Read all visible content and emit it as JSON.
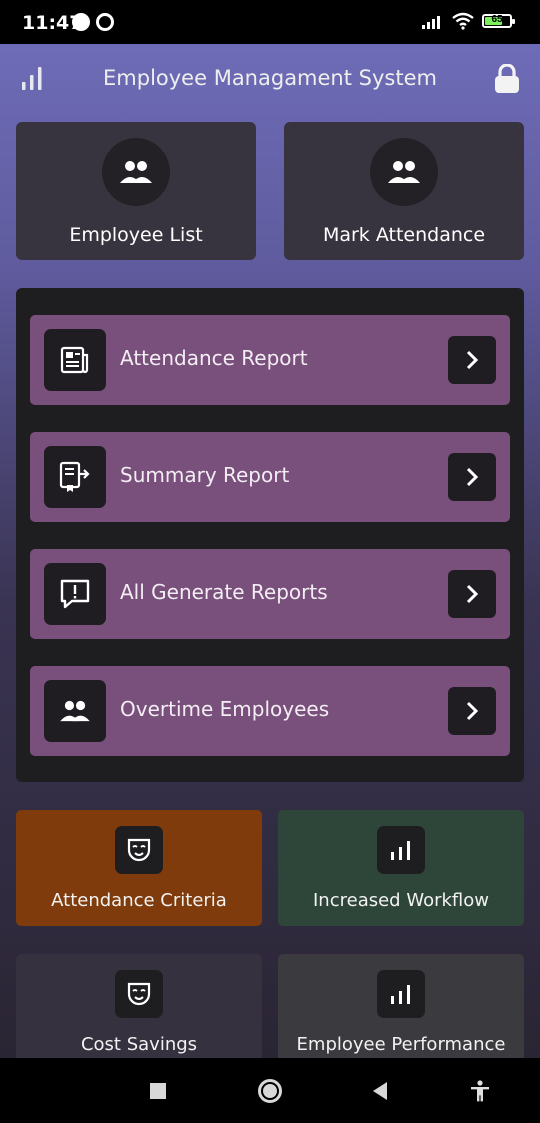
{
  "status_bar": {
    "time": "11:47",
    "battery": "65"
  },
  "app": {
    "title": "Employee Managament System"
  },
  "top_tiles": [
    {
      "label": "Employee List",
      "icon": "people-icon"
    },
    {
      "label": "Mark Attendance",
      "icon": "people-icon"
    }
  ],
  "reports": [
    {
      "label": "Attendance Report",
      "icon": "newspaper-icon"
    },
    {
      "label": "Summary Report",
      "icon": "export-document-icon"
    },
    {
      "label": "All Generate Reports",
      "icon": "feedback-icon"
    },
    {
      "label": "Overtime Employees",
      "icon": "people-icon"
    }
  ],
  "cards": [
    {
      "label": "Attendance Criteria",
      "icon": "mask-icon",
      "color": "#7f3b0b"
    },
    {
      "label": "Increased Workflow",
      "icon": "bar-chart-icon",
      "color": "#2e4639"
    },
    {
      "label": "Cost Savings",
      "icon": "mask-icon",
      "color": "#35313f"
    },
    {
      "label": "Employee Performance",
      "icon": "bar-chart-icon",
      "color": "#3a3a3f"
    }
  ],
  "colors": {
    "report_bg": "#794f7b",
    "panel_bg": "#1e1d20",
    "tile_bg": "#38343f"
  }
}
